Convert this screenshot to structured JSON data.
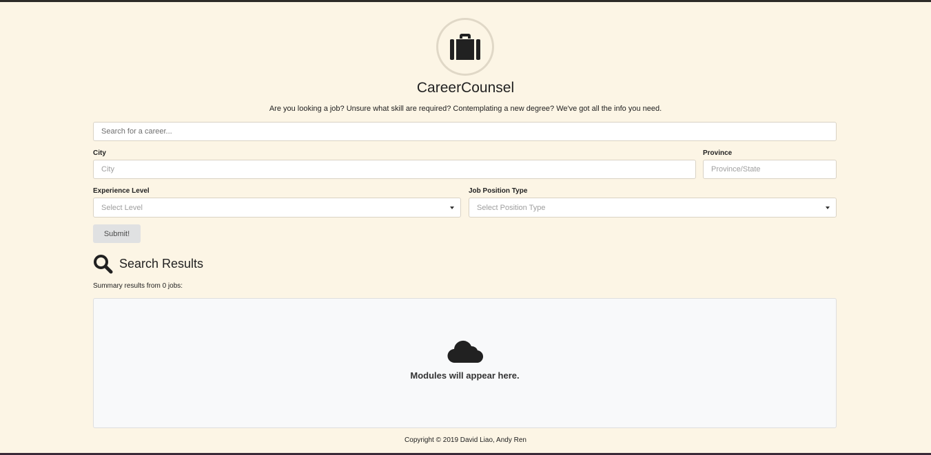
{
  "app": {
    "title": "CareerCounsel",
    "tagline": "Are you looking a job? Unsure what skill are required? Contemplating a new degree? We've got all the info you need.",
    "logo_icon": "briefcase-icon"
  },
  "search": {
    "placeholder": "Search for a career...",
    "value": ""
  },
  "location": {
    "city_label": "City",
    "city_placeholder": "City",
    "province_label": "Province",
    "province_placeholder": "Province/State"
  },
  "filters": {
    "experience_label": "Experience Level",
    "experience_value": "Select Level",
    "position_label": "Job Position Type",
    "position_value": "Select Position Type"
  },
  "submit_label": "Submit!",
  "results": {
    "title": "Search Results",
    "icon": "search-icon",
    "summary": "Summary results from 0 jobs:",
    "empty_icon": "cloud-icon",
    "empty_message": "Modules will appear here."
  },
  "footer": {
    "copyright": "Copyright © 2019 David Liao, Andy Ren"
  },
  "colors": {
    "background": "#fcf5e5",
    "panel": "#f8f9fa",
    "button": "#e0e1e2",
    "text": "#212121"
  }
}
